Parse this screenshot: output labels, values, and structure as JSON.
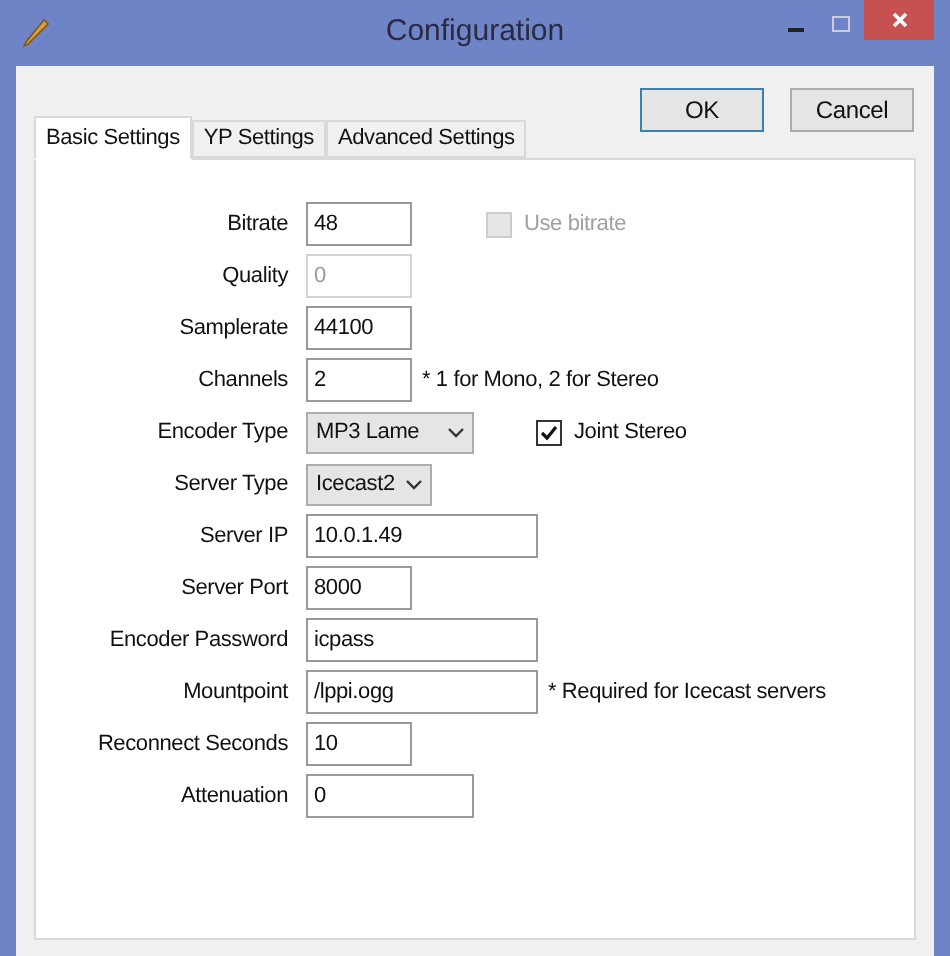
{
  "window": {
    "title": "Configuration"
  },
  "buttons": [
    {
      "label": "OK",
      "default": true
    },
    {
      "label": "Cancel",
      "default": false
    }
  ],
  "tabs": [
    {
      "label": "Basic Settings",
      "selected": true
    },
    {
      "label": "YP Settings",
      "selected": false
    },
    {
      "label": "Advanced Settings",
      "selected": false
    }
  ],
  "rows": [
    {
      "label": "Bitrate",
      "kind": "text",
      "value": "48",
      "disabled": false,
      "extra": {
        "kind": "checkbox",
        "label": "Use bitrate",
        "checked": false,
        "disabled": true
      }
    },
    {
      "label": "Quality",
      "kind": "text",
      "value": "0",
      "disabled": true
    },
    {
      "label": "Samplerate",
      "kind": "text",
      "value": "44100",
      "disabled": false
    },
    {
      "label": "Channels",
      "kind": "text",
      "value": "2",
      "disabled": false,
      "extra": {
        "kind": "note",
        "text": "* 1 for Mono, 2 for Stereo"
      }
    },
    {
      "label": "Encoder Type",
      "kind": "select",
      "value": "MP3 Lame",
      "disabled": false,
      "extra": {
        "kind": "checkbox",
        "label": "Joint Stereo",
        "checked": true,
        "disabled": false
      }
    },
    {
      "label": "Server Type",
      "kind": "select",
      "value": "Icecast2",
      "disabled": false
    },
    {
      "label": "Server IP",
      "kind": "text",
      "value": "10.0.1.49",
      "disabled": false
    },
    {
      "label": "Server Port",
      "kind": "text",
      "value": "8000",
      "disabled": false
    },
    {
      "label": "Encoder Password",
      "kind": "text",
      "value": "icpass",
      "disabled": false
    },
    {
      "label": "Mountpoint",
      "kind": "text",
      "value": "/lppi.ogg",
      "disabled": false,
      "extra": {
        "kind": "note",
        "text": "* Required for Icecast servers"
      }
    },
    {
      "label": "Reconnect Seconds",
      "kind": "text",
      "value": "10",
      "disabled": false
    },
    {
      "label": "Attenuation",
      "kind": "text",
      "value": "0",
      "disabled": false
    }
  ]
}
